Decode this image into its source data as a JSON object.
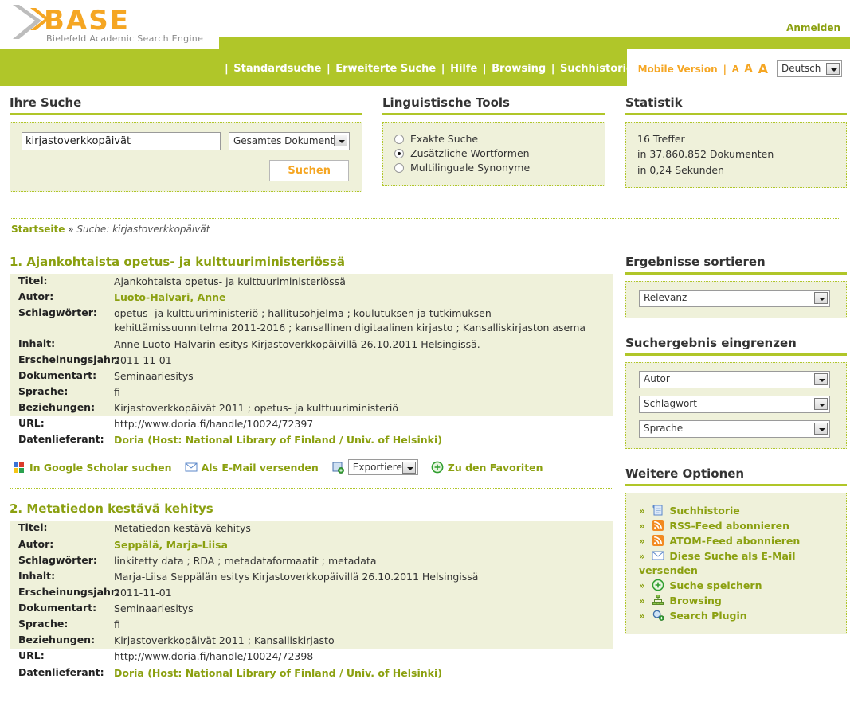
{
  "header": {
    "logo_text": "BASE",
    "logo_subtitle": "Bielefeld Academic Search Engine",
    "login_label": "Anmelden",
    "nav": [
      {
        "label": "Standardsuche"
      },
      {
        "label": "Erweiterte Suche"
      },
      {
        "label": "Hilfe"
      },
      {
        "label": "Browsing"
      },
      {
        "label": "Suchhistorie"
      }
    ],
    "nav_separator": "|",
    "mobile_version": "Mobile Version",
    "font_sizes": [
      "A",
      "A",
      "A"
    ],
    "language_selected": "Deutsch"
  },
  "search_panel": {
    "heading": "Ihre Suche",
    "query_value": "kirjastoverkkopäivät",
    "query_placeholder": "",
    "scope_selected": "Gesamtes Dokument",
    "submit_label": "Suchen"
  },
  "linguistic_panel": {
    "heading": "Linguistische Tools",
    "options": [
      {
        "label": "Exakte Suche",
        "selected": false
      },
      {
        "label": "Zusätzliche Wortformen",
        "selected": true
      },
      {
        "label": "Multilinguale Synonyme",
        "selected": false
      }
    ]
  },
  "statistics_panel": {
    "heading": "Statistik",
    "lines": [
      "16 Treffer",
      "in 37.860.852 Dokumenten",
      "in 0,24 Sekunden"
    ]
  },
  "breadcrumb": {
    "home": "Startseite",
    "separator": "»",
    "current": "Suche: kirjastoverkkopäivät"
  },
  "results": [
    {
      "title": "1. Ajankohtaista opetus- ja kulttuuriministeriössä",
      "fields": [
        {
          "label": "Titel:",
          "value": "Ajankohtaista opetus- ja kulttuuriministeriössä",
          "link": false
        },
        {
          "label": "Autor:",
          "value": "Luoto-Halvari, Anne",
          "link": true
        },
        {
          "label": "Schlagwörter:",
          "value": "opetus- ja kulttuuriministeriö ; hallitusohjelma ; koulutuksen ja tutkimuksen kehittämissuunnitelma 2011-2016 ; kansallinen digitaalinen kirjasto ; Kansalliskirjaston asema",
          "link": false
        },
        {
          "label": "Inhalt:",
          "value": "Anne Luoto-Halvarin esitys Kirjastoverkkopäivillä 26.10.2011 Helsingissä.",
          "link": false
        },
        {
          "label": "Erscheinungsjahr:",
          "value": "2011-11-01",
          "link": false
        },
        {
          "label": "Dokumentart:",
          "value": "Seminaariesitys",
          "link": false
        },
        {
          "label": "Sprache:",
          "value": "fi",
          "link": false
        },
        {
          "label": "Beziehungen:",
          "value": "Kirjastoverkkopäivät 2011 ; opetus- ja kulttuuriministeriö",
          "link": false
        }
      ],
      "tail_fields": [
        {
          "label": "URL:",
          "value": "http://www.doria.fi/handle/10024/72397",
          "link": false
        },
        {
          "label": "Datenlieferant:",
          "value": "Doria (Host: National Library of Finland / Univ. of Helsinki)",
          "link": true
        }
      ],
      "actions": {
        "google_scholar": "In Google Scholar suchen",
        "email": "Als E-Mail versenden",
        "export_selected": "Exportieren",
        "favorites": "Zu den Favoriten"
      }
    },
    {
      "title": "2. Metatiedon kestävä kehitys",
      "fields": [
        {
          "label": "Titel:",
          "value": "Metatiedon kestävä kehitys",
          "link": false
        },
        {
          "label": "Autor:",
          "value": "Seppälä, Marja-Liisa",
          "link": true
        },
        {
          "label": "Schlagwörter:",
          "value": "linkitetty data ; RDA ; metadataformaatit ; metadata",
          "link": false
        },
        {
          "label": "Inhalt:",
          "value": "Marja-Liisa Seppälän esitys Kirjastoverkkopäivillä 26.10.2011 Helsingissä",
          "link": false
        },
        {
          "label": "Erscheinungsjahr:",
          "value": "2011-11-01",
          "link": false
        },
        {
          "label": "Dokumentart:",
          "value": "Seminaariesitys",
          "link": false
        },
        {
          "label": "Sprache:",
          "value": "fi",
          "link": false
        },
        {
          "label": "Beziehungen:",
          "value": "Kirjastoverkkopäivät 2011 ; Kansalliskirjasto",
          "link": false
        }
      ],
      "tail_fields": [
        {
          "label": "URL:",
          "value": "http://www.doria.fi/handle/10024/72398",
          "link": false
        },
        {
          "label": "Datenlieferant:",
          "value": "Doria (Host: National Library of Finland / Univ. of Helsinki)",
          "link": true
        }
      ]
    }
  ],
  "sidebar": {
    "sort": {
      "heading": "Ergebnisse sortieren",
      "selected": "Relevanz"
    },
    "refine": {
      "heading": "Suchergebnis eingrenzen",
      "selects": [
        "Autor",
        "Schlagwort",
        "Sprache"
      ]
    },
    "more_options": {
      "heading": "Weitere Optionen",
      "chevron": "»",
      "items": [
        {
          "label": "Suchhistorie",
          "icon": "history-icon"
        },
        {
          "label": "RSS-Feed abonnieren",
          "icon": "rss-icon"
        },
        {
          "label": "ATOM-Feed abonnieren",
          "icon": "rss-icon"
        },
        {
          "label": "Diese Suche als E-Mail versenden",
          "icon": "envelope-icon"
        },
        {
          "label": "Suche speichern",
          "icon": "plus-circle-icon"
        },
        {
          "label": "Browsing",
          "icon": "sitemap-icon"
        },
        {
          "label": "Search Plugin",
          "icon": "search-plugin-icon"
        }
      ]
    }
  },
  "colors": {
    "brand_green": "#b0c629",
    "brand_orange": "#f5a623",
    "link_green": "#8ba010",
    "panel_bg": "#eff1da"
  }
}
